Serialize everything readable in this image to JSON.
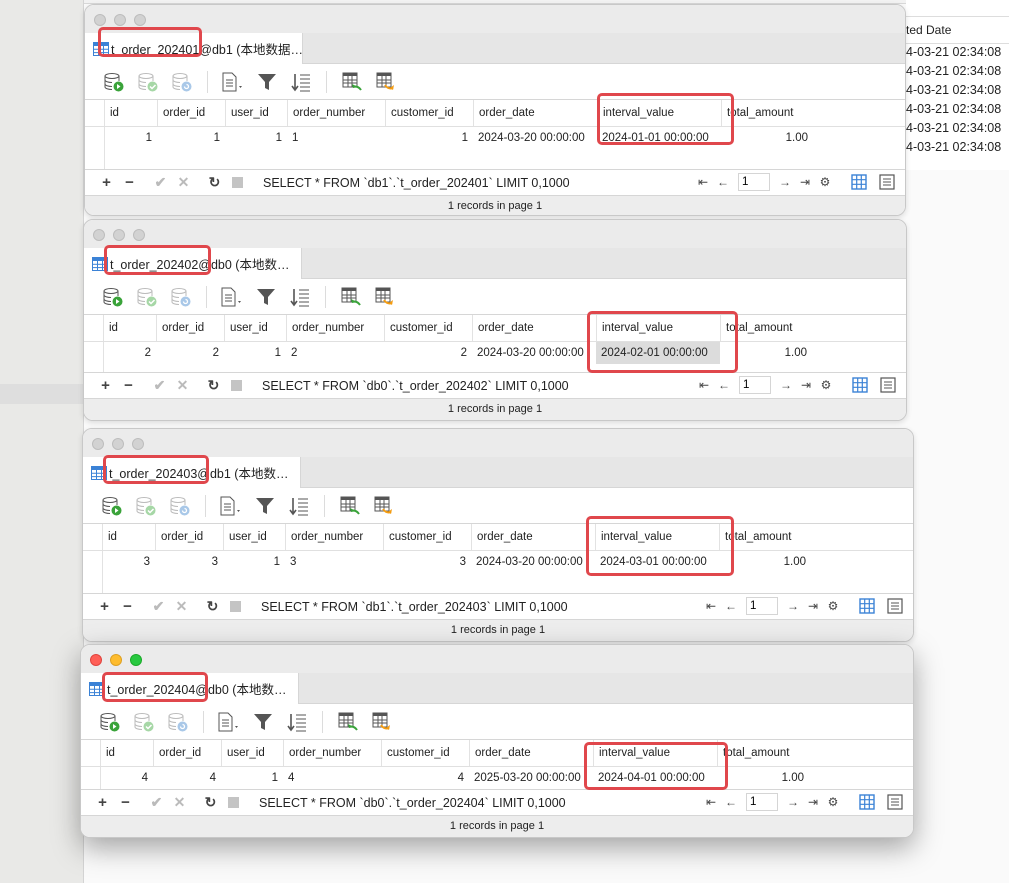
{
  "background": {
    "right_panel": {
      "header": "ted Date",
      "rows": [
        "4-03-21 02:34:08",
        "4-03-21 02:34:08",
        "4-03-21 02:34:08",
        "4-03-21 02:34:08",
        "4-03-21 02:34:08",
        "4-03-21 02:34:08"
      ]
    }
  },
  "columns": [
    "id",
    "order_id",
    "user_id",
    "order_number",
    "customer_id",
    "order_date",
    "interval_value",
    "total_amount"
  ],
  "windows": [
    {
      "tab_title": "t_order_202401@db1 (本地数据…",
      "row": {
        "id": "1",
        "order_id": "1",
        "user_id": "1",
        "order_number": "1",
        "customer_id": "1",
        "order_date": "2024-03-20 00:00:00",
        "interval_value": "2024-01-01 00:00:00",
        "total_amount": "1.00"
      },
      "sql": "SELECT * FROM `db1`.`t_order_202401` LIMIT 0,1000",
      "page": "1",
      "footer": "1 records in page 1"
    },
    {
      "tab_title": "t_order_202402@db0 (本地数…",
      "row": {
        "id": "2",
        "order_id": "2",
        "user_id": "1",
        "order_number": "2",
        "customer_id": "2",
        "order_date": "2024-03-20 00:00:00",
        "interval_value": "2024-02-01 00:00:00",
        "total_amount": "1.00"
      },
      "sql": "SELECT * FROM `db0`.`t_order_202402` LIMIT 0,1000",
      "page": "1",
      "footer": "1 records in page 1"
    },
    {
      "tab_title": "t_order_202403@db1 (本地数…",
      "row": {
        "id": "3",
        "order_id": "3",
        "user_id": "1",
        "order_number": "3",
        "customer_id": "3",
        "order_date": "2024-03-20 00:00:00",
        "interval_value": "2024-03-01 00:00:00",
        "total_amount": "1.00"
      },
      "sql": "SELECT * FROM `db1`.`t_order_202403` LIMIT 0,1000",
      "page": "1",
      "footer": "1 records in page 1"
    },
    {
      "tab_title": "t_order_202404@db0 (本地数…",
      "row": {
        "id": "4",
        "order_id": "4",
        "user_id": "1",
        "order_number": "4",
        "customer_id": "4",
        "order_date": "2025-03-20 00:00:00",
        "interval_value": "2024-04-01 00:00:00",
        "total_amount": "1.00"
      },
      "sql": "SELECT * FROM `db0`.`t_order_202404` LIMIT 0,1000",
      "page": "1",
      "footer": "1 records in page 1"
    }
  ],
  "colors": {
    "highlight": "#e0474c",
    "accent_blue": "#3b82d6",
    "run_green": "#3aa33a"
  }
}
